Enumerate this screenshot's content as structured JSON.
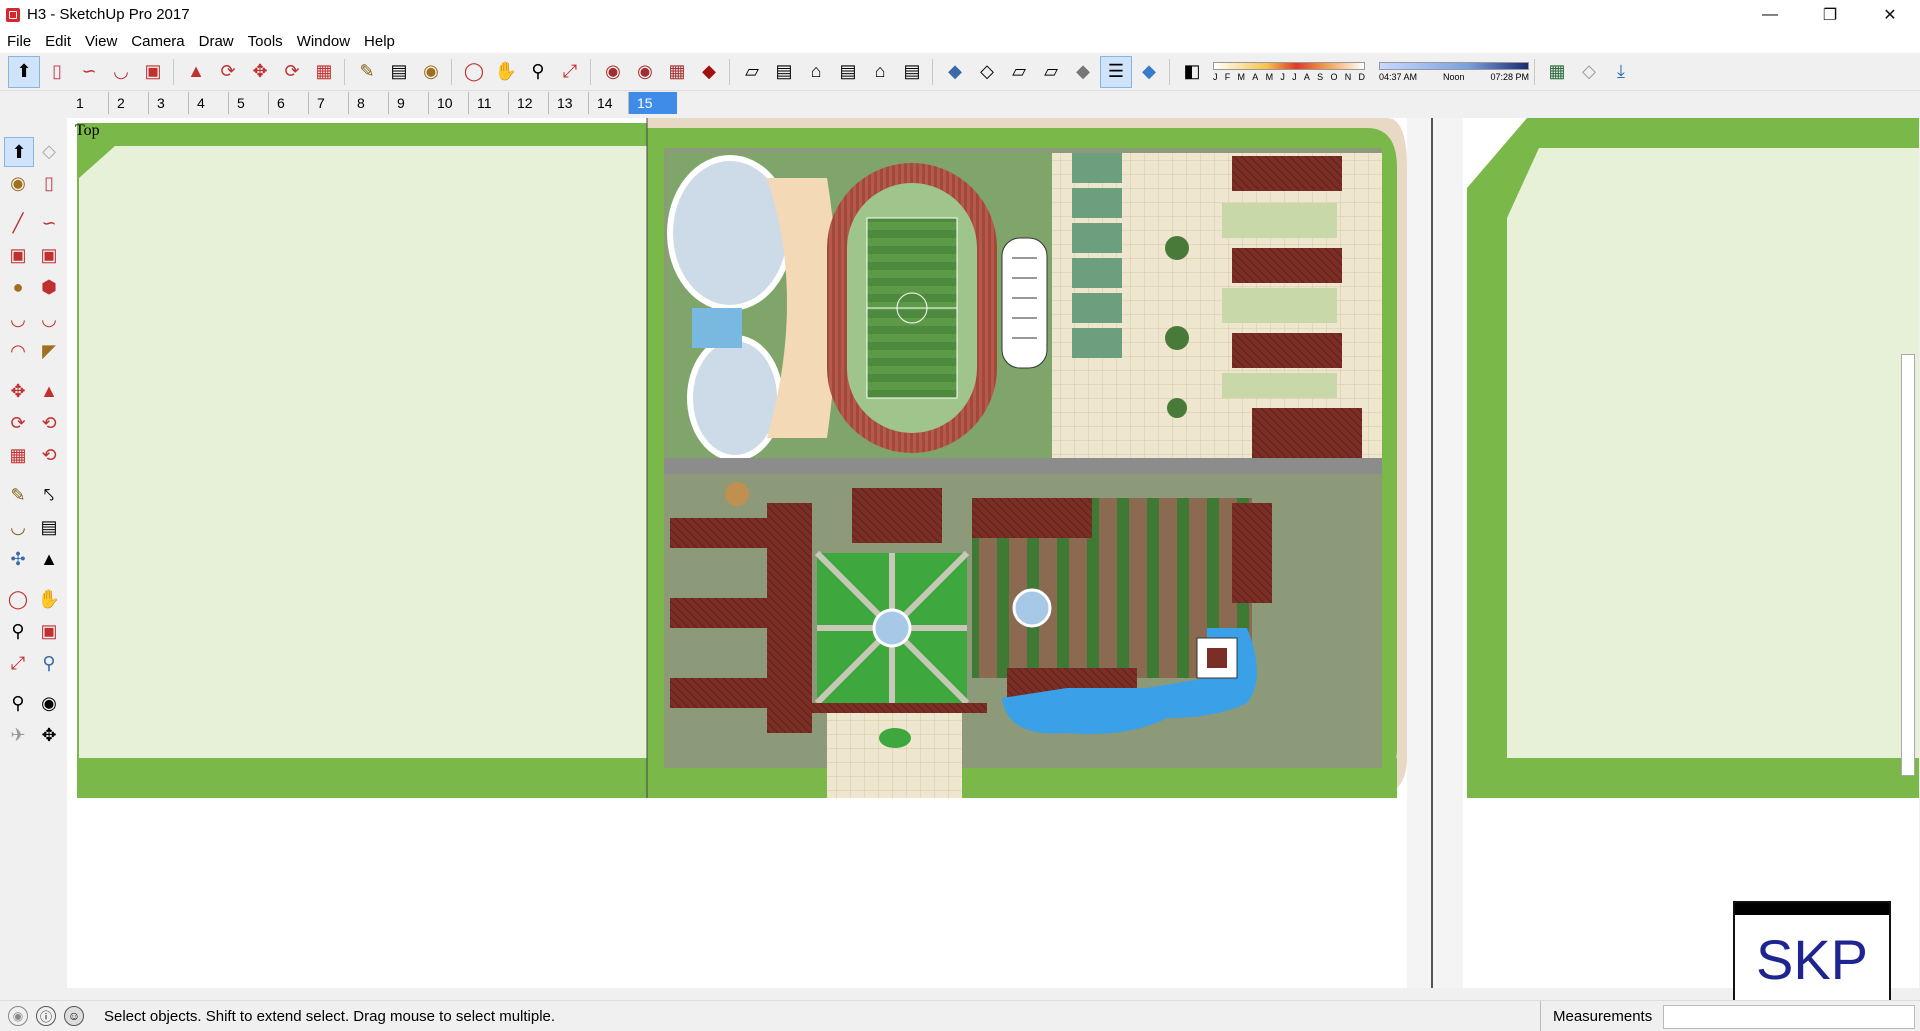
{
  "window": {
    "title": "H3 - SketchUp Pro 2017"
  },
  "menu": [
    "File",
    "Edit",
    "View",
    "Camera",
    "Draw",
    "Tools",
    "Window",
    "Help"
  ],
  "scenes": {
    "tabs": [
      "1",
      "2",
      "3",
      "4",
      "5",
      "6",
      "7",
      "8",
      "9",
      "10",
      "11",
      "12",
      "13",
      "14",
      "15"
    ],
    "active": "15"
  },
  "shadow": {
    "months": [
      "J",
      "F",
      "M",
      "A",
      "M",
      "J",
      "J",
      "A",
      "S",
      "O",
      "N",
      "D"
    ],
    "time_start": "04:37 AM",
    "time_mid": "Noon",
    "time_end": "07:28 PM"
  },
  "viewport": {
    "view_label": "Top"
  },
  "status": {
    "hint": "Select objects. Shift to extend select. Drag mouse to select multiple.",
    "measurements_label": "Measurements",
    "measurements_value": ""
  },
  "badge": {
    "text": "SKP"
  },
  "colors": {
    "accent": "#3e8be8",
    "grass": "#7bb84a",
    "lawn": "#e7f1d8",
    "roof": "#7a2e26",
    "water": "#3aa0e8",
    "road": "#707070"
  }
}
